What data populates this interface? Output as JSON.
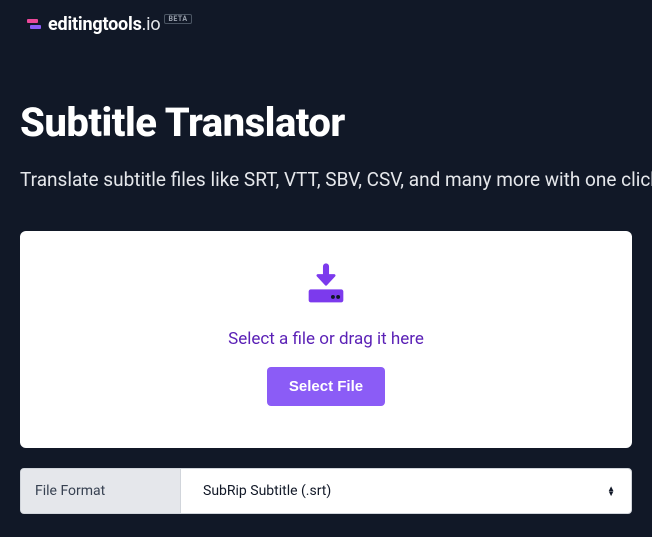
{
  "brand": {
    "name_bold": "editingtools",
    "name_suffix": ".io",
    "badge": "BETA"
  },
  "page": {
    "title": "Subtitle Translator",
    "subtitle": "Translate subtitle files like SRT, VTT, SBV, CSV, and many more with one click."
  },
  "upload": {
    "prompt": "Select a file or drag it here",
    "button": "Select File"
  },
  "format": {
    "label": "File Format",
    "selected": "SubRip Subtitle (.srt)"
  }
}
